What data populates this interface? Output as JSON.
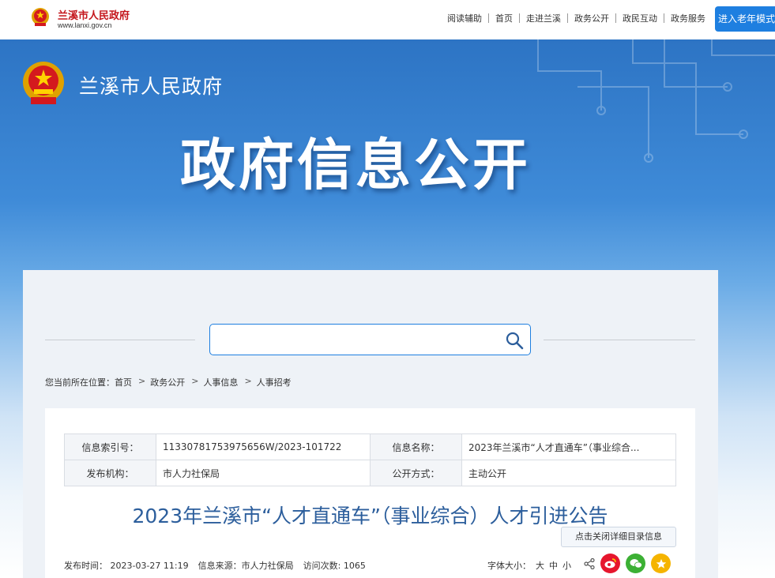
{
  "topbar": {
    "site_name": "兰溪市人民政府",
    "site_url": "www.lanxi.gov.cn",
    "nav": [
      "阅读辅助",
      "首页",
      "走进兰溪",
      "政务公开",
      "政民互动",
      "政务服务"
    ],
    "elder_mode_label": "进入老年模式"
  },
  "banner": {
    "site_name": "兰溪市人民政府",
    "title": "政府信息公开"
  },
  "search": {
    "placeholder": "",
    "icon": "search-icon"
  },
  "breadcrumb": {
    "prefix": "您当前所在位置：",
    "items": [
      "首页",
      "政务公开",
      "人事信息",
      "人事招考"
    ]
  },
  "info": {
    "index_label": "信息索引号：",
    "index_value": "11330781753975656W/2023-101722",
    "name_label": "信息名称：",
    "name_value": "2023年兰溪市“人才直通车”（事业综合...",
    "publisher_label": "发布机构：",
    "publisher_value": "市人力社保局",
    "method_label": "公开方式：",
    "method_value": "主动公开"
  },
  "article": {
    "title": "2023年兰溪市“人才直通车”（事业综合）人才引进公告",
    "toggle_label": "点击关闭详细目录信息",
    "publish_time": "发布时间：  2023-03-27 11:19",
    "source": "信息来源：市人力社保局",
    "visits": "访问次数: 1065",
    "font_size_label": "字体大小：",
    "font_large": "大",
    "font_medium": "中",
    "font_small": "小"
  },
  "share": {
    "icons": [
      "share-icon",
      "weibo-icon",
      "wechat-icon",
      "favorite-icon"
    ]
  },
  "colors": {
    "accent": "#1e7fe0",
    "brand_red": "#c4161c",
    "title_blue": "#2c5e9c",
    "banner_blue": "#2d74c4"
  }
}
